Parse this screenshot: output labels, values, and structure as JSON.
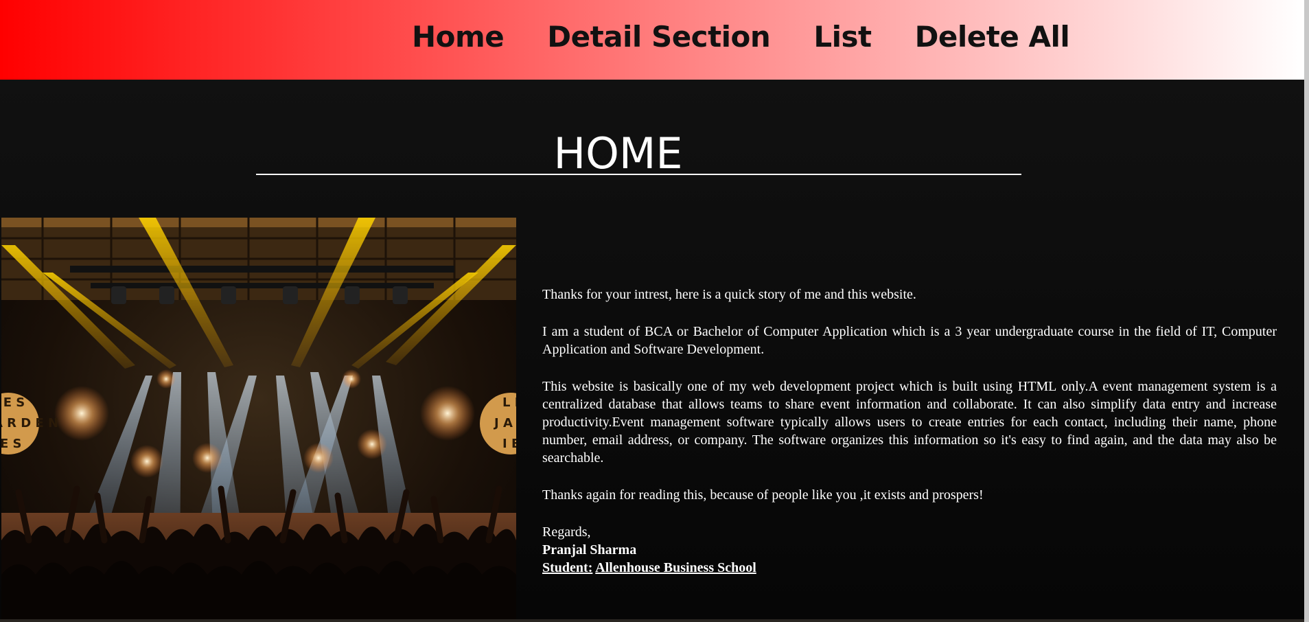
{
  "nav": {
    "items": [
      "Home",
      "Detail Section",
      "List",
      "Delete All"
    ]
  },
  "page": {
    "title": "HOME"
  },
  "story": {
    "p1": "Thanks for your intrest, here is a quick story of me and this website.",
    "p2": "I am a student of BCA or Bachelor of Computer Application which is a 3 year undergraduate course in the field of IT, Computer Application and Software Development.",
    "p3": "This website is basically one of my web development project which is built using HTML only.A event management system is a centralized database that allows teams to share event information and collaborate. It can also simplify data entry and increase productivity.Event management software typically allows users to create entries for each contact, including their name, phone number, email address, or company. The software organizes this information so it's easy to find again, and the data may also be searchable.",
    "p4": "Thanks again for reading this, because of people like you ,it exists and prospers!",
    "regards": "Regards,",
    "name": "Pranjal Sharma",
    "student_label": "Student:",
    "school": "Allenhouse Business School"
  },
  "image": {
    "icon": "concert-photo",
    "lettering_left": [
      "L E S",
      "J A R D E N",
      "I E S"
    ],
    "lettering_right": [
      "L E",
      "J A R D",
      "I E"
    ]
  },
  "colors": {
    "nav_gradient_start": "#ff0000",
    "nav_gradient_end": "#ffffff",
    "background": "#0b0b0b",
    "text": "#ffffff"
  }
}
